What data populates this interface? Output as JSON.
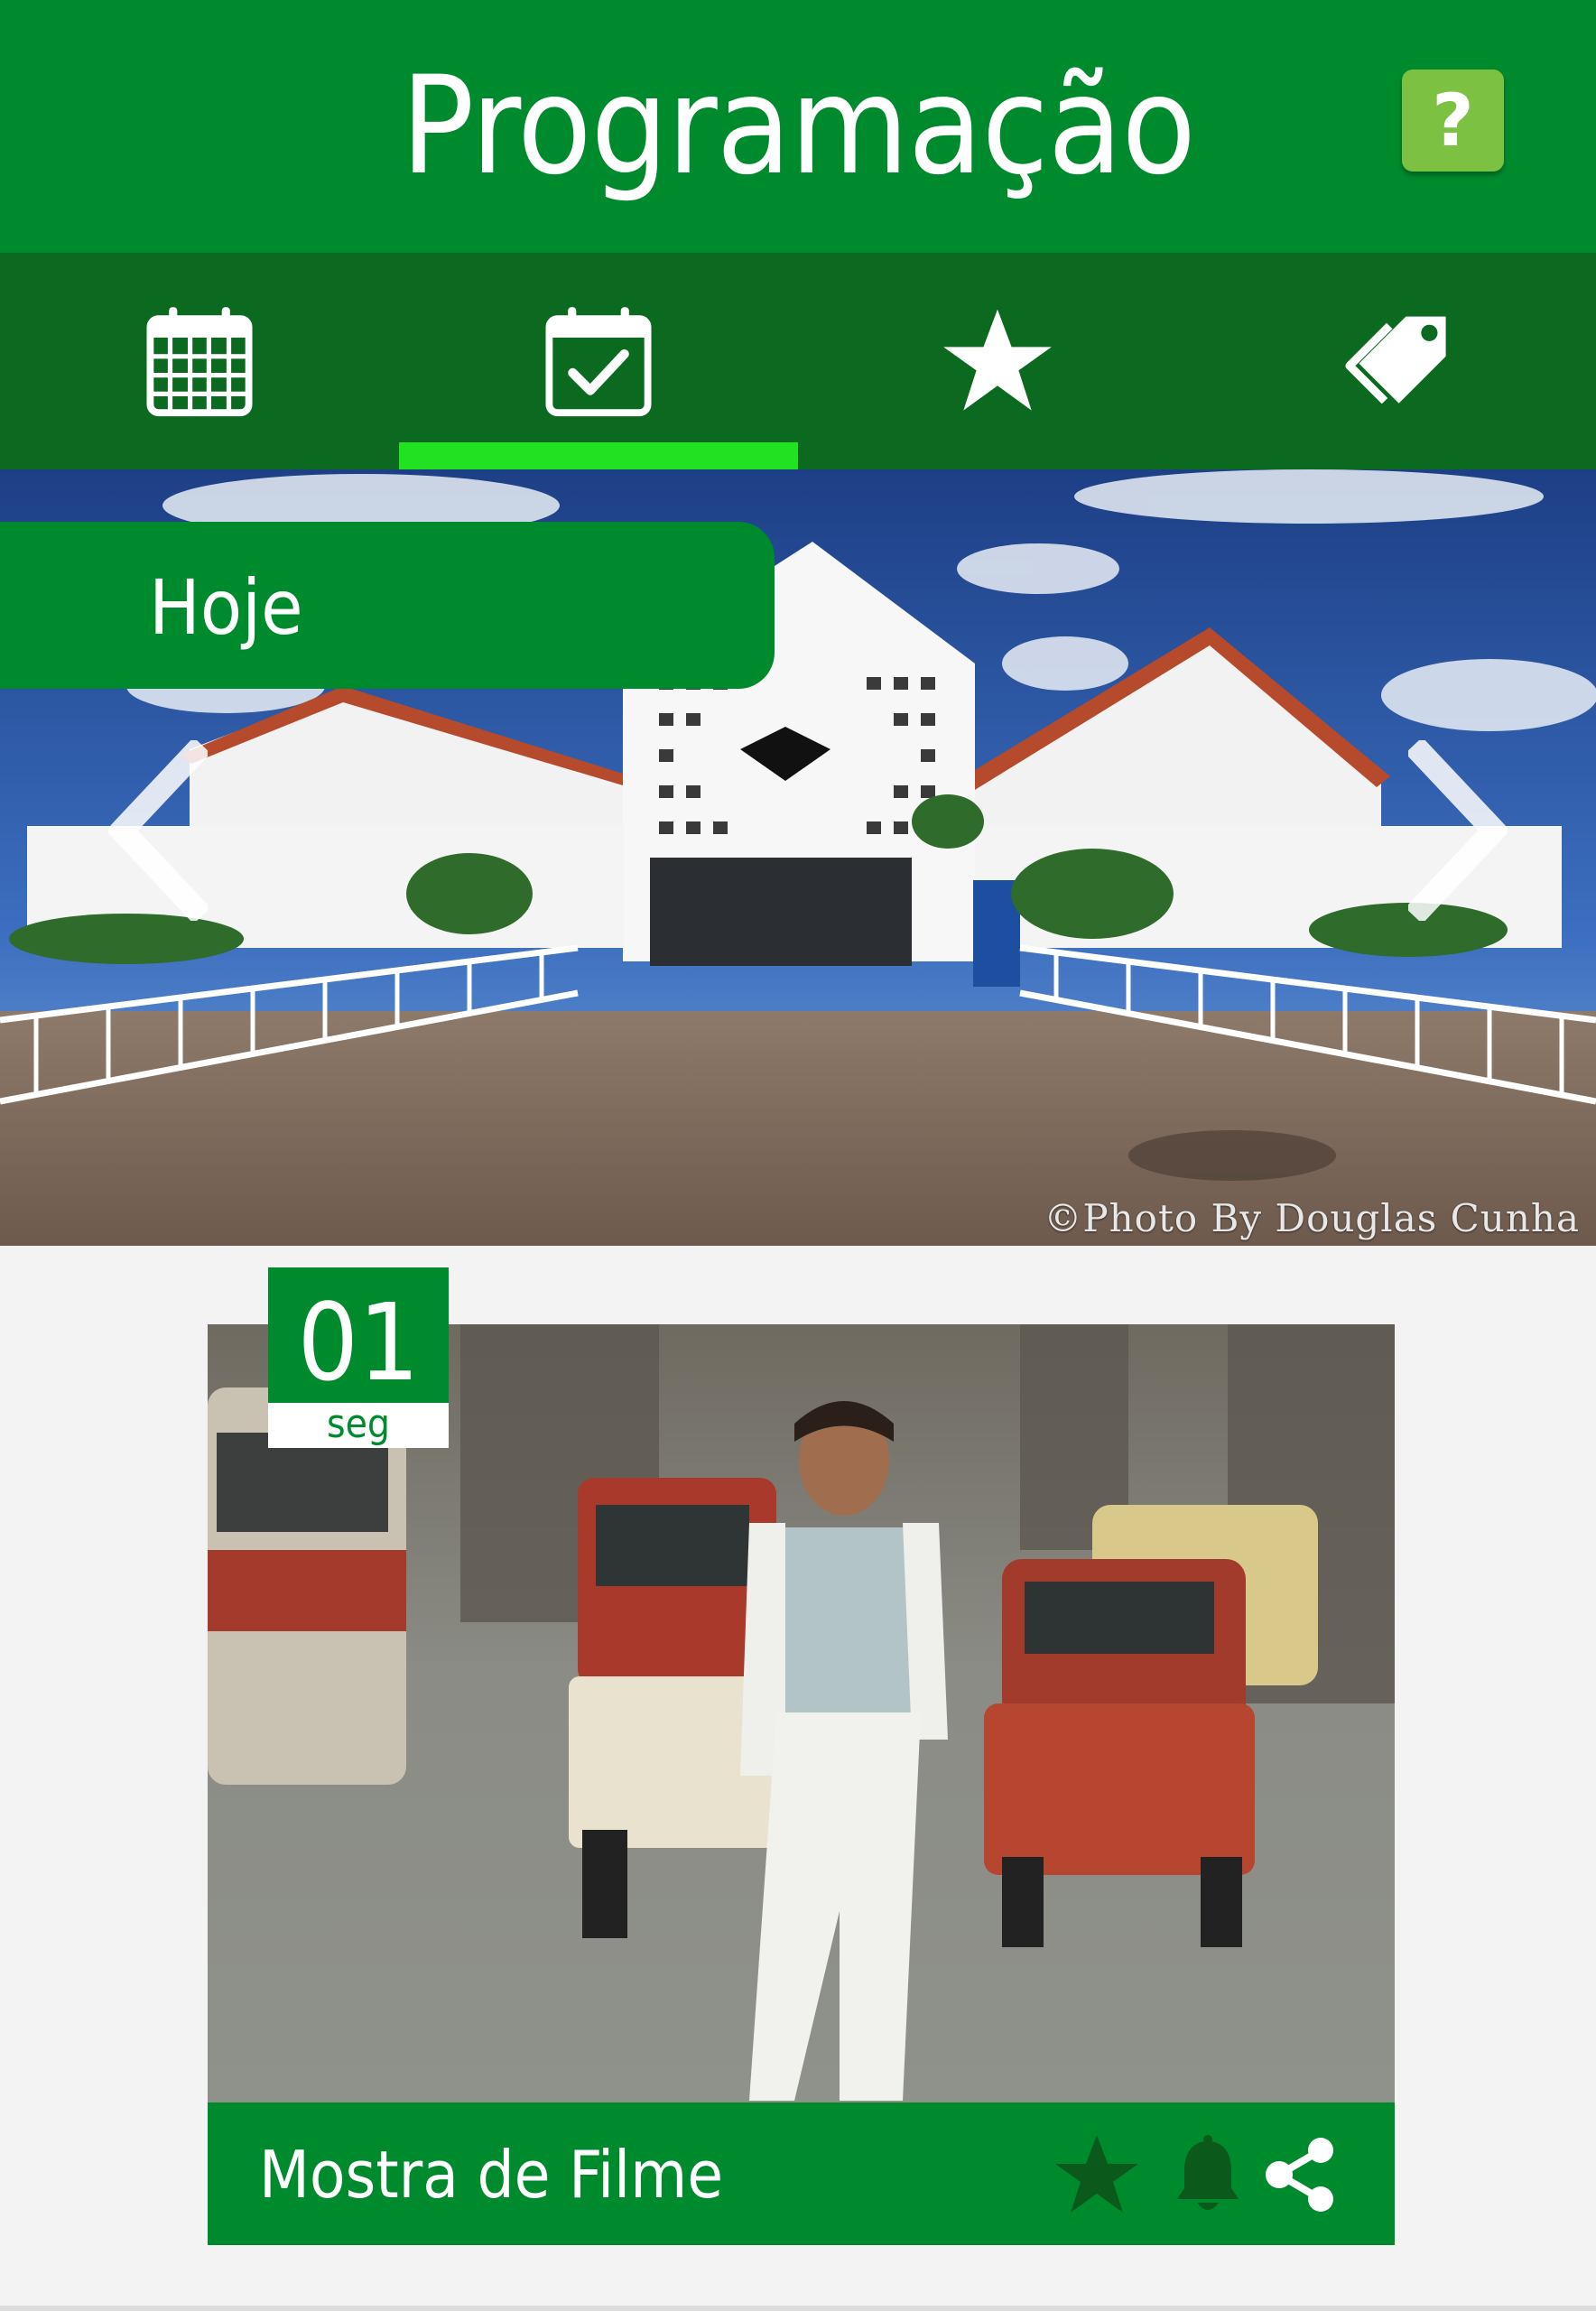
{
  "header": {
    "title": "Programação",
    "help_label": "?"
  },
  "tabs": [
    {
      "icon": "calendar-icon"
    },
    {
      "icon": "calendar-check-icon",
      "active": true
    },
    {
      "icon": "star-icon"
    },
    {
      "icon": "tag-icon"
    }
  ],
  "colors": {
    "header_green": "#008a2e",
    "tabbar_green": "#0b6a1f",
    "tab_indicator": "#22e022",
    "help_button": "#7dc142",
    "favorite_star": "#0b5a1c",
    "background": "#f3f3f3"
  },
  "hero": {
    "day_label": "Hoje",
    "photo_credit": "©Photo By Douglas Cunha"
  },
  "event": {
    "day": "01",
    "weekday": "seg",
    "title": "Mostra de Filme"
  }
}
